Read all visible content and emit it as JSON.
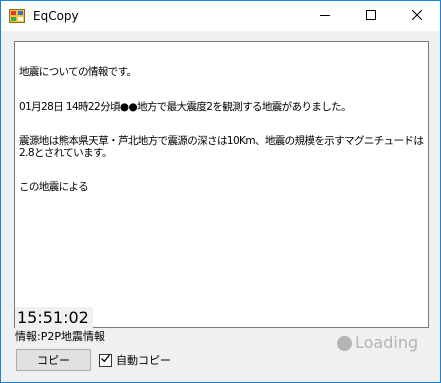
{
  "window": {
    "title": "EqCopy",
    "border_color": "#1883d7"
  },
  "icons": {
    "app": "app-icon",
    "minimize": "minimize-icon",
    "maximize": "maximize-icon",
    "close": "close-icon",
    "checkmark": "checkmark-icon",
    "loading": "loading-dot-icon"
  },
  "textbox": {
    "lines": [
      "地震についての情報です。",
      "01月28日 14時22分頃●●地方で最大震度2を観測する地震がありました。",
      "震源地は熊本県天草・芦北地方で震源の深さは10Km、地震の規模を示すマグニチュードは2.8とされています。",
      "この地震による"
    ]
  },
  "status": {
    "time": "15:51:02",
    "source": "情報:P2P地震情報",
    "loading": "Loading",
    "loading_color": "#b4b4b4"
  },
  "controls": {
    "copy_label": "コピー",
    "auto_copy_label": "自動コピー",
    "auto_copy_checked": true
  }
}
